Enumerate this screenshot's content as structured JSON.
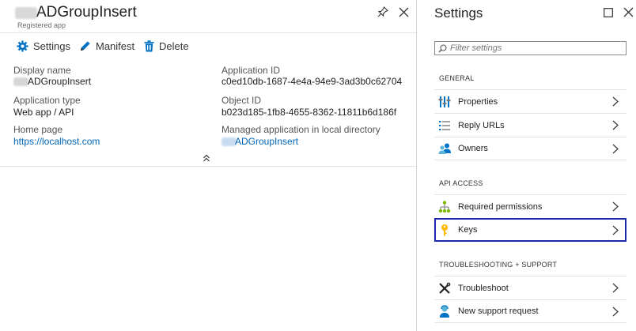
{
  "left_blade": {
    "title": "ADGroupInsert",
    "subtitle": "Registered app",
    "toolbar": {
      "settings_label": "Settings",
      "manifest_label": "Manifest",
      "delete_label": "Delete"
    },
    "essentials": {
      "display_name_label": "Display name",
      "display_name_value": "ADGroupInsert",
      "app_type_label": "Application type",
      "app_type_value": "Web app / API",
      "home_page_label": "Home page",
      "home_page_value": "https://localhost.com",
      "app_id_label": "Application ID",
      "app_id_value": "c0ed10db-1687-4e4a-94e9-3ad3b0c62704",
      "object_id_label": "Object ID",
      "object_id_value": "b023d185-1fb8-4655-8362-11811b6d186f",
      "managed_app_label": "Managed application in local directory",
      "managed_app_value": "ADGroupInsert"
    },
    "icons": [
      "pin-icon",
      "close-icon",
      "gear-icon",
      "pencil-icon",
      "trash-icon",
      "double-chevron-up-icon"
    ]
  },
  "settings_blade": {
    "title": "Settings",
    "filter_placeholder": "Filter settings",
    "sections": {
      "general": {
        "header": "GENERAL",
        "items": [
          {
            "label": "Properties",
            "icon": "properties-icon"
          },
          {
            "label": "Reply URLs",
            "icon": "list-icon"
          },
          {
            "label": "Owners",
            "icon": "people-icon"
          }
        ]
      },
      "api_access": {
        "header": "API ACCESS",
        "items": [
          {
            "label": "Required permissions",
            "icon": "hierarchy-icon"
          },
          {
            "label": "Keys",
            "icon": "key-icon",
            "selected": true
          }
        ]
      },
      "troubleshooting": {
        "header": "TROUBLESHOOTING + SUPPORT",
        "items": [
          {
            "label": "Troubleshoot",
            "icon": "wrench-icon"
          },
          {
            "label": "New support request",
            "icon": "support-person-icon"
          }
        ]
      }
    },
    "colors": {
      "selection_outline": "#1d2ba8",
      "link": "#0066b8",
      "accent_blue": "#0072c6"
    }
  }
}
